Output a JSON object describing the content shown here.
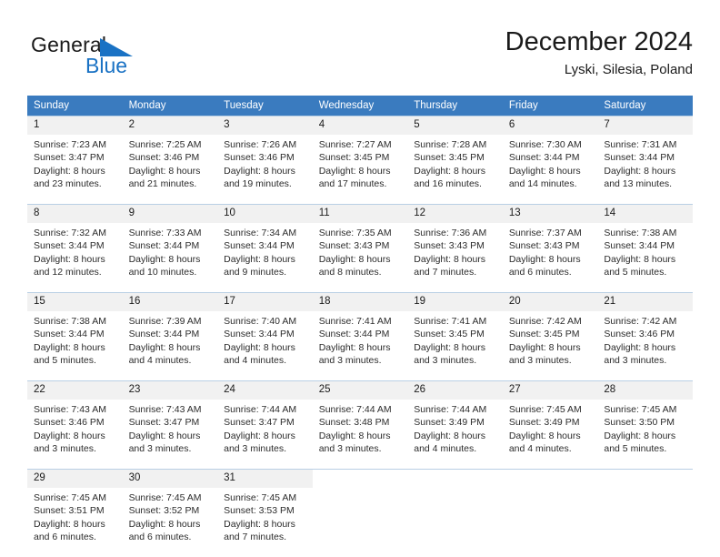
{
  "brand": {
    "name_top": "General",
    "name_bottom": "Blue",
    "accent_color": "#1a72c4",
    "logo_icon": "triangle-icon"
  },
  "header": {
    "title": "December 2024",
    "subtitle": "Lyski, Silesia, Poland"
  },
  "calendar": {
    "header_bg": "#3a7bbf",
    "daynum_bg": "#f1f1f1",
    "grid_line_color": "#b9cfe4",
    "weekdays": [
      "Sunday",
      "Monday",
      "Tuesday",
      "Wednesday",
      "Thursday",
      "Friday",
      "Saturday"
    ],
    "weeks": [
      [
        {
          "day": "1",
          "sunrise": "Sunrise: 7:23 AM",
          "sunset": "Sunset: 3:47 PM",
          "daylight1": "Daylight: 8 hours",
          "daylight2": "and 23 minutes."
        },
        {
          "day": "2",
          "sunrise": "Sunrise: 7:25 AM",
          "sunset": "Sunset: 3:46 PM",
          "daylight1": "Daylight: 8 hours",
          "daylight2": "and 21 minutes."
        },
        {
          "day": "3",
          "sunrise": "Sunrise: 7:26 AM",
          "sunset": "Sunset: 3:46 PM",
          "daylight1": "Daylight: 8 hours",
          "daylight2": "and 19 minutes."
        },
        {
          "day": "4",
          "sunrise": "Sunrise: 7:27 AM",
          "sunset": "Sunset: 3:45 PM",
          "daylight1": "Daylight: 8 hours",
          "daylight2": "and 17 minutes."
        },
        {
          "day": "5",
          "sunrise": "Sunrise: 7:28 AM",
          "sunset": "Sunset: 3:45 PM",
          "daylight1": "Daylight: 8 hours",
          "daylight2": "and 16 minutes."
        },
        {
          "day": "6",
          "sunrise": "Sunrise: 7:30 AM",
          "sunset": "Sunset: 3:44 PM",
          "daylight1": "Daylight: 8 hours",
          "daylight2": "and 14 minutes."
        },
        {
          "day": "7",
          "sunrise": "Sunrise: 7:31 AM",
          "sunset": "Sunset: 3:44 PM",
          "daylight1": "Daylight: 8 hours",
          "daylight2": "and 13 minutes."
        }
      ],
      [
        {
          "day": "8",
          "sunrise": "Sunrise: 7:32 AM",
          "sunset": "Sunset: 3:44 PM",
          "daylight1": "Daylight: 8 hours",
          "daylight2": "and 12 minutes."
        },
        {
          "day": "9",
          "sunrise": "Sunrise: 7:33 AM",
          "sunset": "Sunset: 3:44 PM",
          "daylight1": "Daylight: 8 hours",
          "daylight2": "and 10 minutes."
        },
        {
          "day": "10",
          "sunrise": "Sunrise: 7:34 AM",
          "sunset": "Sunset: 3:44 PM",
          "daylight1": "Daylight: 8 hours",
          "daylight2": "and 9 minutes."
        },
        {
          "day": "11",
          "sunrise": "Sunrise: 7:35 AM",
          "sunset": "Sunset: 3:43 PM",
          "daylight1": "Daylight: 8 hours",
          "daylight2": "and 8 minutes."
        },
        {
          "day": "12",
          "sunrise": "Sunrise: 7:36 AM",
          "sunset": "Sunset: 3:43 PM",
          "daylight1": "Daylight: 8 hours",
          "daylight2": "and 7 minutes."
        },
        {
          "day": "13",
          "sunrise": "Sunrise: 7:37 AM",
          "sunset": "Sunset: 3:43 PM",
          "daylight1": "Daylight: 8 hours",
          "daylight2": "and 6 minutes."
        },
        {
          "day": "14",
          "sunrise": "Sunrise: 7:38 AM",
          "sunset": "Sunset: 3:44 PM",
          "daylight1": "Daylight: 8 hours",
          "daylight2": "and 5 minutes."
        }
      ],
      [
        {
          "day": "15",
          "sunrise": "Sunrise: 7:38 AM",
          "sunset": "Sunset: 3:44 PM",
          "daylight1": "Daylight: 8 hours",
          "daylight2": "and 5 minutes."
        },
        {
          "day": "16",
          "sunrise": "Sunrise: 7:39 AM",
          "sunset": "Sunset: 3:44 PM",
          "daylight1": "Daylight: 8 hours",
          "daylight2": "and 4 minutes."
        },
        {
          "day": "17",
          "sunrise": "Sunrise: 7:40 AM",
          "sunset": "Sunset: 3:44 PM",
          "daylight1": "Daylight: 8 hours",
          "daylight2": "and 4 minutes."
        },
        {
          "day": "18",
          "sunrise": "Sunrise: 7:41 AM",
          "sunset": "Sunset: 3:44 PM",
          "daylight1": "Daylight: 8 hours",
          "daylight2": "and 3 minutes."
        },
        {
          "day": "19",
          "sunrise": "Sunrise: 7:41 AM",
          "sunset": "Sunset: 3:45 PM",
          "daylight1": "Daylight: 8 hours",
          "daylight2": "and 3 minutes."
        },
        {
          "day": "20",
          "sunrise": "Sunrise: 7:42 AM",
          "sunset": "Sunset: 3:45 PM",
          "daylight1": "Daylight: 8 hours",
          "daylight2": "and 3 minutes."
        },
        {
          "day": "21",
          "sunrise": "Sunrise: 7:42 AM",
          "sunset": "Sunset: 3:46 PM",
          "daylight1": "Daylight: 8 hours",
          "daylight2": "and 3 minutes."
        }
      ],
      [
        {
          "day": "22",
          "sunrise": "Sunrise: 7:43 AM",
          "sunset": "Sunset: 3:46 PM",
          "daylight1": "Daylight: 8 hours",
          "daylight2": "and 3 minutes."
        },
        {
          "day": "23",
          "sunrise": "Sunrise: 7:43 AM",
          "sunset": "Sunset: 3:47 PM",
          "daylight1": "Daylight: 8 hours",
          "daylight2": "and 3 minutes."
        },
        {
          "day": "24",
          "sunrise": "Sunrise: 7:44 AM",
          "sunset": "Sunset: 3:47 PM",
          "daylight1": "Daylight: 8 hours",
          "daylight2": "and 3 minutes."
        },
        {
          "day": "25",
          "sunrise": "Sunrise: 7:44 AM",
          "sunset": "Sunset: 3:48 PM",
          "daylight1": "Daylight: 8 hours",
          "daylight2": "and 3 minutes."
        },
        {
          "day": "26",
          "sunrise": "Sunrise: 7:44 AM",
          "sunset": "Sunset: 3:49 PM",
          "daylight1": "Daylight: 8 hours",
          "daylight2": "and 4 minutes."
        },
        {
          "day": "27",
          "sunrise": "Sunrise: 7:45 AM",
          "sunset": "Sunset: 3:49 PM",
          "daylight1": "Daylight: 8 hours",
          "daylight2": "and 4 minutes."
        },
        {
          "day": "28",
          "sunrise": "Sunrise: 7:45 AM",
          "sunset": "Sunset: 3:50 PM",
          "daylight1": "Daylight: 8 hours",
          "daylight2": "and 5 minutes."
        }
      ],
      [
        {
          "day": "29",
          "sunrise": "Sunrise: 7:45 AM",
          "sunset": "Sunset: 3:51 PM",
          "daylight1": "Daylight: 8 hours",
          "daylight2": "and 6 minutes."
        },
        {
          "day": "30",
          "sunrise": "Sunrise: 7:45 AM",
          "sunset": "Sunset: 3:52 PM",
          "daylight1": "Daylight: 8 hours",
          "daylight2": "and 6 minutes."
        },
        {
          "day": "31",
          "sunrise": "Sunrise: 7:45 AM",
          "sunset": "Sunset: 3:53 PM",
          "daylight1": "Daylight: 8 hours",
          "daylight2": "and 7 minutes."
        },
        {
          "day": "",
          "sunrise": "",
          "sunset": "",
          "daylight1": "",
          "daylight2": ""
        },
        {
          "day": "",
          "sunrise": "",
          "sunset": "",
          "daylight1": "",
          "daylight2": ""
        },
        {
          "day": "",
          "sunrise": "",
          "sunset": "",
          "daylight1": "",
          "daylight2": ""
        },
        {
          "day": "",
          "sunrise": "",
          "sunset": "",
          "daylight1": "",
          "daylight2": ""
        }
      ]
    ]
  }
}
